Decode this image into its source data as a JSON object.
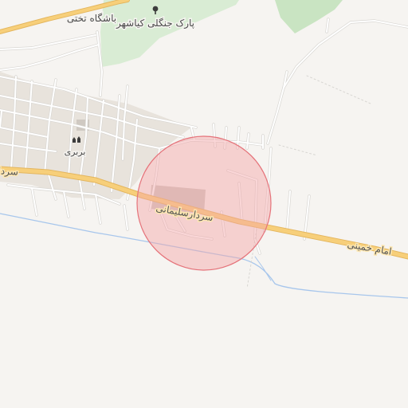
{
  "map": {
    "colors": {
      "background": "#f6f4f1",
      "park": "#c9e4c2",
      "park_light": "#d9ecd4",
      "main_road": "#f7cf7a",
      "main_road_casing": "#e4b65e",
      "minor_road": "#ffffff",
      "minor_road_casing": "#d8d6d2",
      "river": "#a7c6ec",
      "built_area": "#e8e3dc",
      "building_block": "#cfc9c2",
      "highlight_fill": "#f4a3a7",
      "highlight_stroke": "#e5737a"
    },
    "labels": {
      "park_name": "پارک جنگلی کیاشهر",
      "club_name": "باشگاه تختی",
      "village_name": "بربری",
      "road_name_left": "سردا",
      "road_name_main": "سردارسلیمانی",
      "road_name_right": "امام خمینی"
    },
    "icons": {
      "park": "tree-icon",
      "village": "settlement-icon"
    }
  }
}
